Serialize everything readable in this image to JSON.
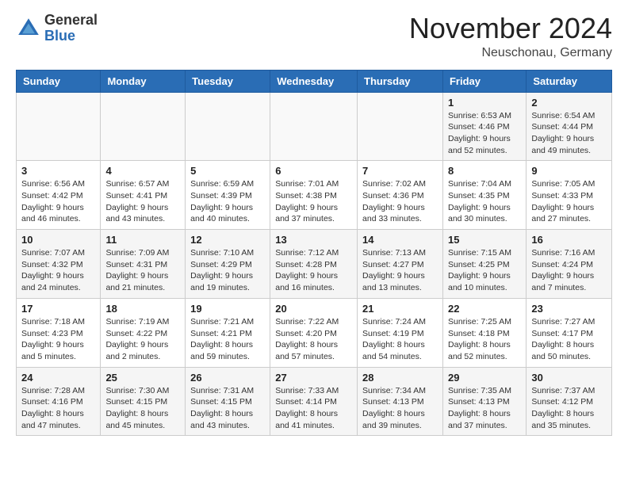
{
  "logo": {
    "general": "General",
    "blue": "Blue"
  },
  "header": {
    "month": "November 2024",
    "location": "Neuschonau, Germany"
  },
  "days_of_week": [
    "Sunday",
    "Monday",
    "Tuesday",
    "Wednesday",
    "Thursday",
    "Friday",
    "Saturday"
  ],
  "weeks": [
    [
      {
        "day": "",
        "info": ""
      },
      {
        "day": "",
        "info": ""
      },
      {
        "day": "",
        "info": ""
      },
      {
        "day": "",
        "info": ""
      },
      {
        "day": "",
        "info": ""
      },
      {
        "day": "1",
        "info": "Sunrise: 6:53 AM\nSunset: 4:46 PM\nDaylight: 9 hours and 52 minutes."
      },
      {
        "day": "2",
        "info": "Sunrise: 6:54 AM\nSunset: 4:44 PM\nDaylight: 9 hours and 49 minutes."
      }
    ],
    [
      {
        "day": "3",
        "info": "Sunrise: 6:56 AM\nSunset: 4:42 PM\nDaylight: 9 hours and 46 minutes."
      },
      {
        "day": "4",
        "info": "Sunrise: 6:57 AM\nSunset: 4:41 PM\nDaylight: 9 hours and 43 minutes."
      },
      {
        "day": "5",
        "info": "Sunrise: 6:59 AM\nSunset: 4:39 PM\nDaylight: 9 hours and 40 minutes."
      },
      {
        "day": "6",
        "info": "Sunrise: 7:01 AM\nSunset: 4:38 PM\nDaylight: 9 hours and 37 minutes."
      },
      {
        "day": "7",
        "info": "Sunrise: 7:02 AM\nSunset: 4:36 PM\nDaylight: 9 hours and 33 minutes."
      },
      {
        "day": "8",
        "info": "Sunrise: 7:04 AM\nSunset: 4:35 PM\nDaylight: 9 hours and 30 minutes."
      },
      {
        "day": "9",
        "info": "Sunrise: 7:05 AM\nSunset: 4:33 PM\nDaylight: 9 hours and 27 minutes."
      }
    ],
    [
      {
        "day": "10",
        "info": "Sunrise: 7:07 AM\nSunset: 4:32 PM\nDaylight: 9 hours and 24 minutes."
      },
      {
        "day": "11",
        "info": "Sunrise: 7:09 AM\nSunset: 4:31 PM\nDaylight: 9 hours and 21 minutes."
      },
      {
        "day": "12",
        "info": "Sunrise: 7:10 AM\nSunset: 4:29 PM\nDaylight: 9 hours and 19 minutes."
      },
      {
        "day": "13",
        "info": "Sunrise: 7:12 AM\nSunset: 4:28 PM\nDaylight: 9 hours and 16 minutes."
      },
      {
        "day": "14",
        "info": "Sunrise: 7:13 AM\nSunset: 4:27 PM\nDaylight: 9 hours and 13 minutes."
      },
      {
        "day": "15",
        "info": "Sunrise: 7:15 AM\nSunset: 4:25 PM\nDaylight: 9 hours and 10 minutes."
      },
      {
        "day": "16",
        "info": "Sunrise: 7:16 AM\nSunset: 4:24 PM\nDaylight: 9 hours and 7 minutes."
      }
    ],
    [
      {
        "day": "17",
        "info": "Sunrise: 7:18 AM\nSunset: 4:23 PM\nDaylight: 9 hours and 5 minutes."
      },
      {
        "day": "18",
        "info": "Sunrise: 7:19 AM\nSunset: 4:22 PM\nDaylight: 9 hours and 2 minutes."
      },
      {
        "day": "19",
        "info": "Sunrise: 7:21 AM\nSunset: 4:21 PM\nDaylight: 8 hours and 59 minutes."
      },
      {
        "day": "20",
        "info": "Sunrise: 7:22 AM\nSunset: 4:20 PM\nDaylight: 8 hours and 57 minutes."
      },
      {
        "day": "21",
        "info": "Sunrise: 7:24 AM\nSunset: 4:19 PM\nDaylight: 8 hours and 54 minutes."
      },
      {
        "day": "22",
        "info": "Sunrise: 7:25 AM\nSunset: 4:18 PM\nDaylight: 8 hours and 52 minutes."
      },
      {
        "day": "23",
        "info": "Sunrise: 7:27 AM\nSunset: 4:17 PM\nDaylight: 8 hours and 50 minutes."
      }
    ],
    [
      {
        "day": "24",
        "info": "Sunrise: 7:28 AM\nSunset: 4:16 PM\nDaylight: 8 hours and 47 minutes."
      },
      {
        "day": "25",
        "info": "Sunrise: 7:30 AM\nSunset: 4:15 PM\nDaylight: 8 hours and 45 minutes."
      },
      {
        "day": "26",
        "info": "Sunrise: 7:31 AM\nSunset: 4:15 PM\nDaylight: 8 hours and 43 minutes."
      },
      {
        "day": "27",
        "info": "Sunrise: 7:33 AM\nSunset: 4:14 PM\nDaylight: 8 hours and 41 minutes."
      },
      {
        "day": "28",
        "info": "Sunrise: 7:34 AM\nSunset: 4:13 PM\nDaylight: 8 hours and 39 minutes."
      },
      {
        "day": "29",
        "info": "Sunrise: 7:35 AM\nSunset: 4:13 PM\nDaylight: 8 hours and 37 minutes."
      },
      {
        "day": "30",
        "info": "Sunrise: 7:37 AM\nSunset: 4:12 PM\nDaylight: 8 hours and 35 minutes."
      }
    ]
  ]
}
